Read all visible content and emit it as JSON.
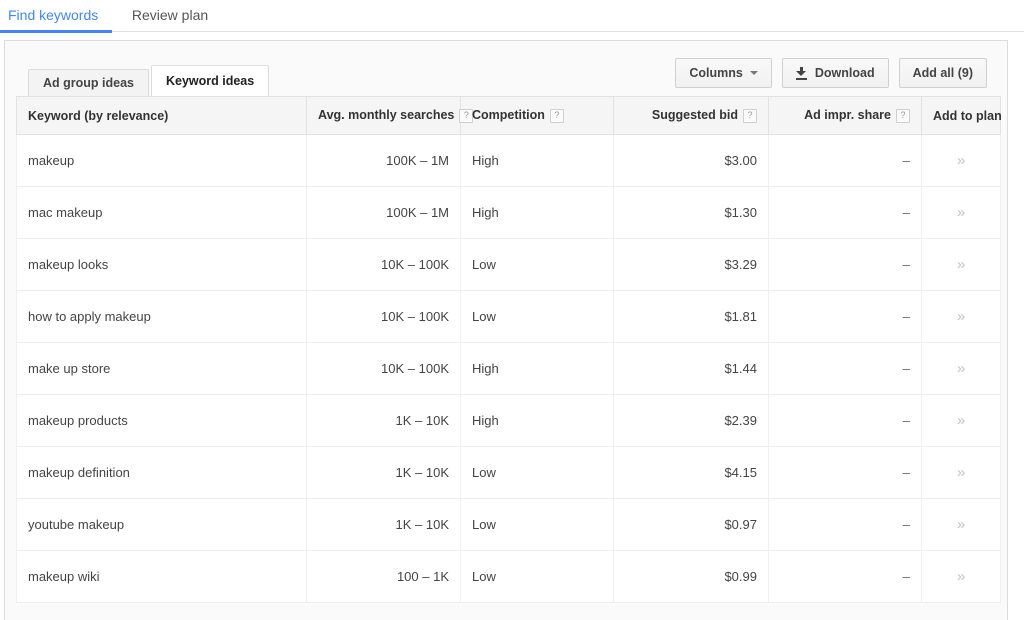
{
  "top_nav": {
    "tabs": [
      {
        "label": "Find keywords",
        "active": true
      },
      {
        "label": "Review plan",
        "active": false
      }
    ]
  },
  "accent_color": "#4285f4",
  "sub_tabs": [
    {
      "label": "Ad group ideas",
      "active": false
    },
    {
      "label": "Keyword ideas",
      "active": true
    }
  ],
  "toolbar": {
    "columns_label": "Columns",
    "columns_caret_icon": "chevron-down-icon",
    "download_label": "Download",
    "download_icon": "download-icon",
    "add_all_label": "Add all (9)"
  },
  "table": {
    "columns": [
      {
        "label": "Keyword (by relevance)",
        "align": "left",
        "help": false
      },
      {
        "label": "Avg. monthly searches",
        "align": "right",
        "help": true,
        "help_glyph": "?"
      },
      {
        "label": "Competition",
        "align": "left",
        "help": true,
        "help_glyph": "?"
      },
      {
        "label": "Suggested bid",
        "align": "right",
        "help": true,
        "help_glyph": "?"
      },
      {
        "label": "Ad impr. share",
        "align": "right",
        "help": true,
        "help_glyph": "?"
      },
      {
        "label": "Add to plan",
        "align": "center",
        "help": false
      }
    ],
    "add_icon_glyph": "»",
    "rows": [
      {
        "keyword": "makeup",
        "searches": "100K – 1M",
        "competition": "High",
        "bid": "$3.00",
        "impr_share": "–",
        "add": "»"
      },
      {
        "keyword": "mac makeup",
        "searches": "100K – 1M",
        "competition": "High",
        "bid": "$1.30",
        "impr_share": "–",
        "add": "»"
      },
      {
        "keyword": "makeup looks",
        "searches": "10K – 100K",
        "competition": "Low",
        "bid": "$3.29",
        "impr_share": "–",
        "add": "»"
      },
      {
        "keyword": "how to apply makeup",
        "searches": "10K – 100K",
        "competition": "Low",
        "bid": "$1.81",
        "impr_share": "–",
        "add": "»"
      },
      {
        "keyword": "make up store",
        "searches": "10K – 100K",
        "competition": "High",
        "bid": "$1.44",
        "impr_share": "–",
        "add": "»"
      },
      {
        "keyword": "makeup products",
        "searches": "1K – 10K",
        "competition": "High",
        "bid": "$2.39",
        "impr_share": "–",
        "add": "»"
      },
      {
        "keyword": "makeup definition",
        "searches": "1K – 10K",
        "competition": "Low",
        "bid": "$4.15",
        "impr_share": "–",
        "add": "»"
      },
      {
        "keyword": "youtube makeup",
        "searches": "1K – 10K",
        "competition": "Low",
        "bid": "$0.97",
        "impr_share": "–",
        "add": "»"
      },
      {
        "keyword": "makeup wiki",
        "searches": "100 – 1K",
        "competition": "Low",
        "bid": "$0.99",
        "impr_share": "–",
        "add": "»"
      }
    ]
  }
}
